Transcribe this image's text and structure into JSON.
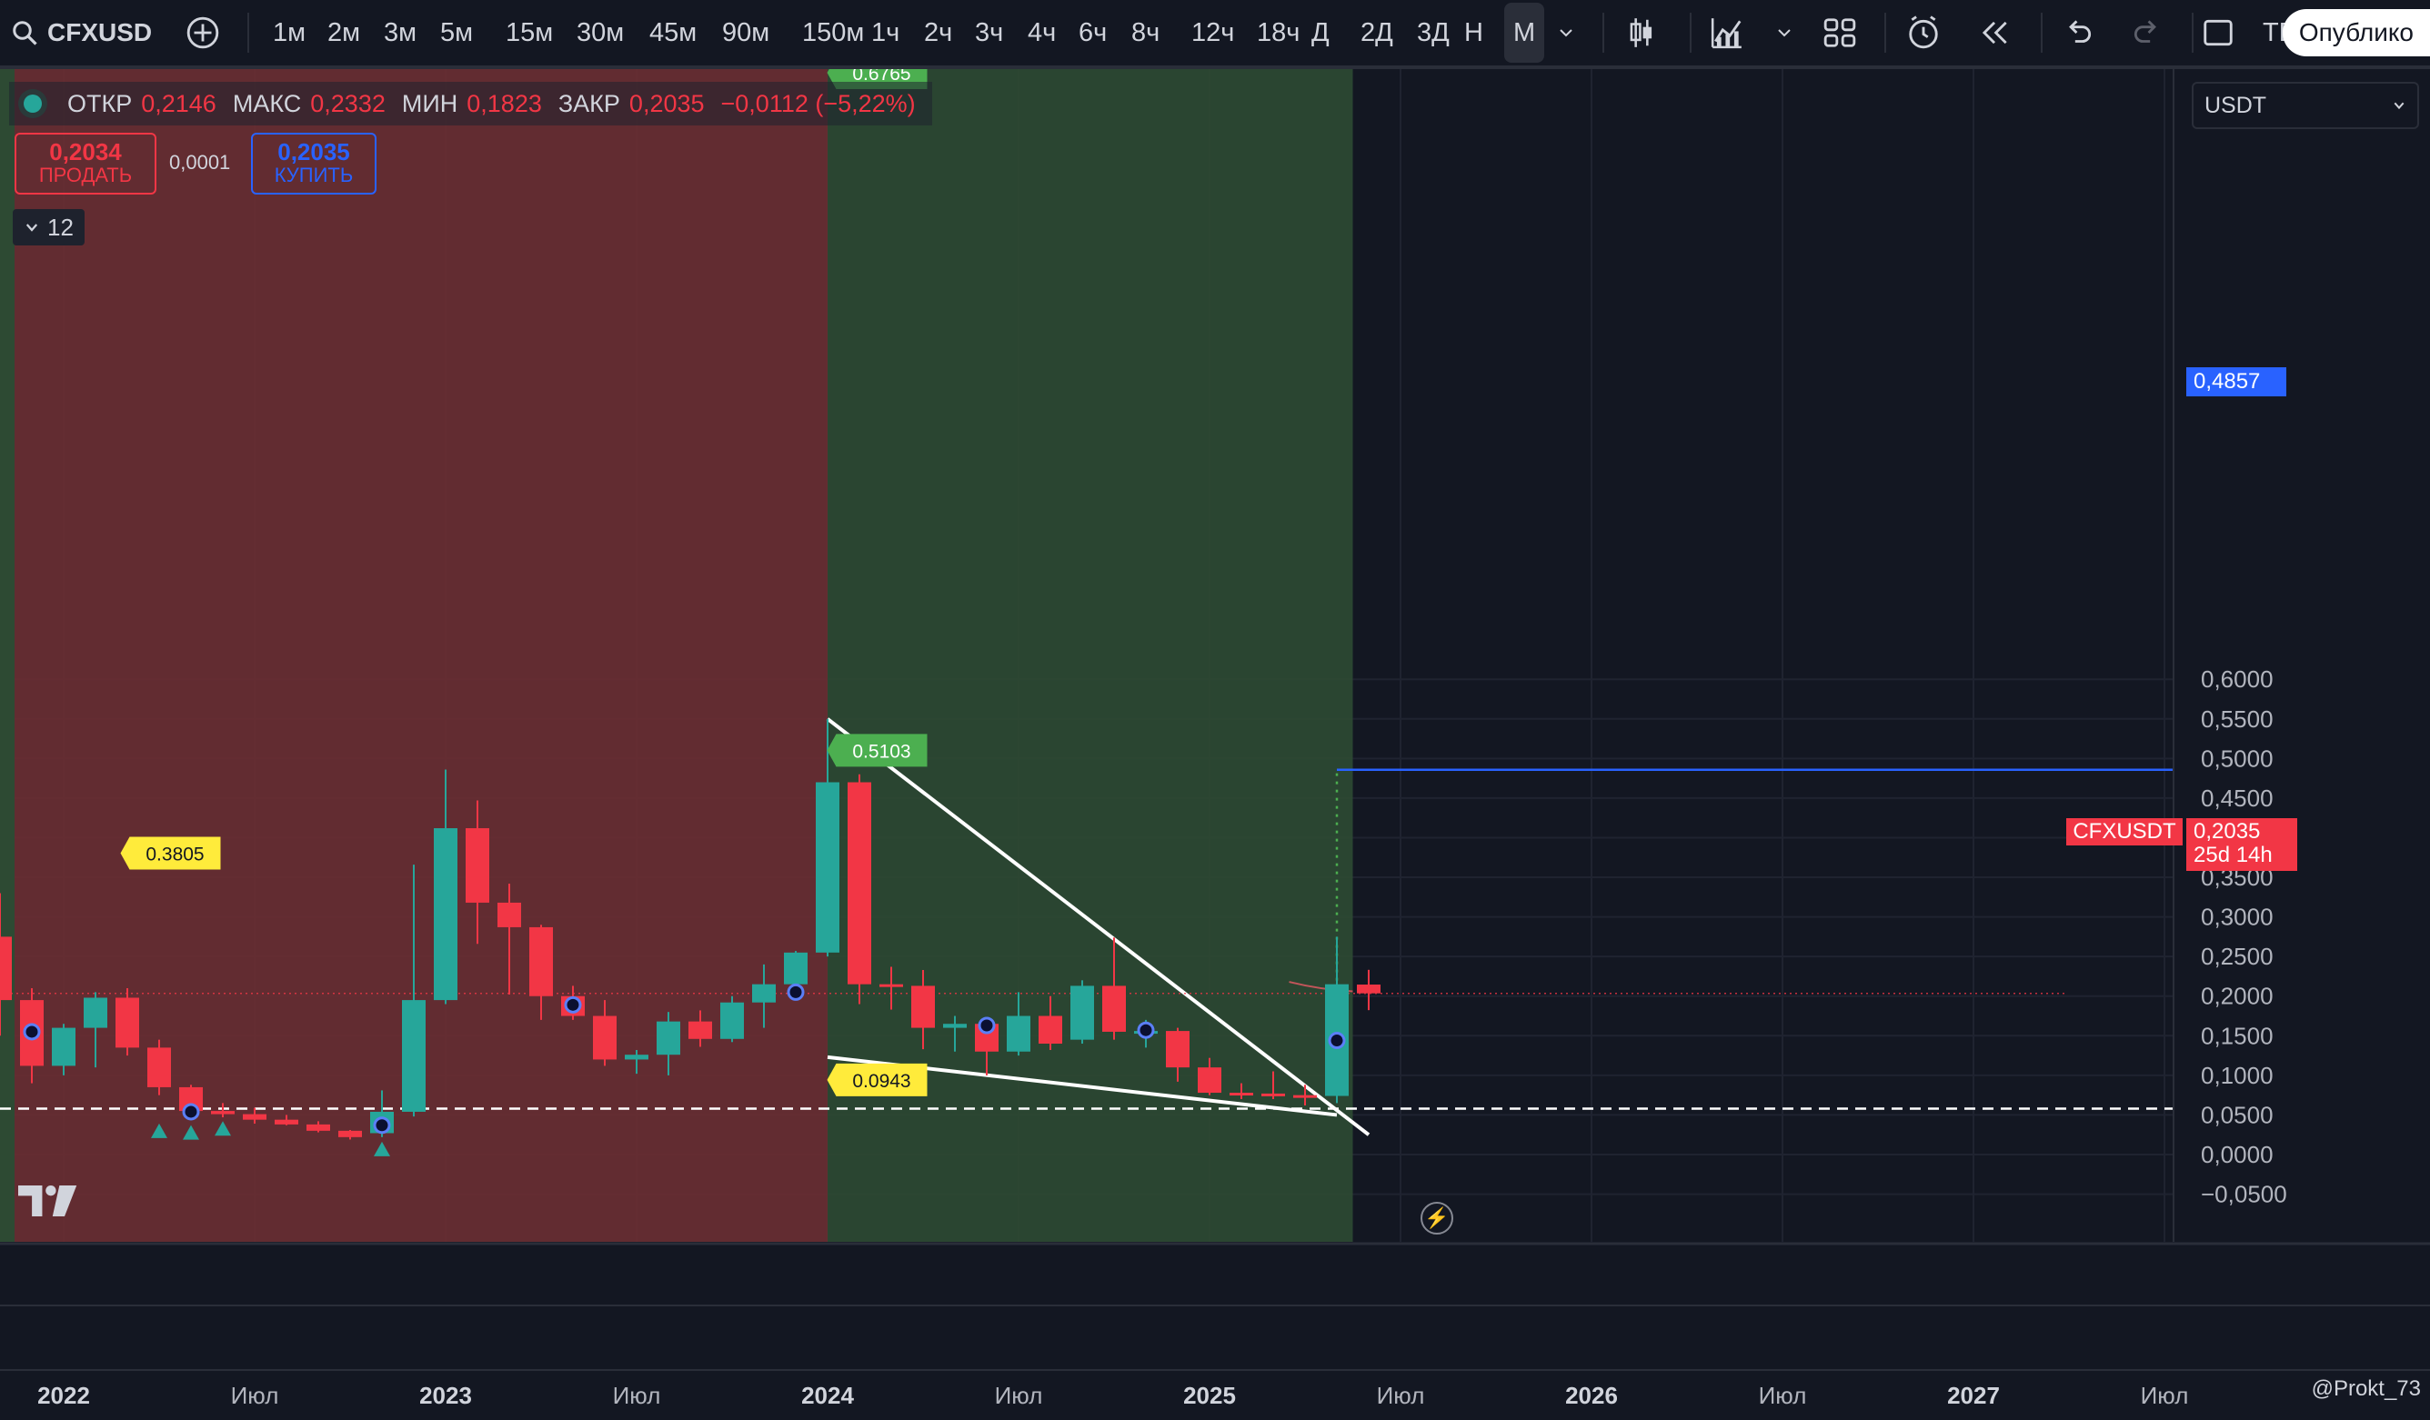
{
  "toolbar": {
    "symbol": "CFXUSD",
    "timeframes": [
      "1м",
      "2м",
      "3м",
      "5м",
      "15м",
      "30м",
      "45м",
      "90м",
      "150м",
      "1ч",
      "2ч",
      "3ч",
      "4ч",
      "6ч",
      "8ч",
      "12ч",
      "18ч",
      "Д",
      "2Д",
      "3Д",
      "Н",
      "М"
    ],
    "active_timeframe": "М",
    "truncated_label": "ТЕ",
    "publish_label": "Опублико"
  },
  "legend": {
    "open_label": "ОТКР",
    "open_value": "0,2146",
    "high_label": "МАКС",
    "high_value": "0,2332",
    "low_label": "МИН",
    "low_value": "0,1823",
    "close_label": "ЗАКР",
    "close_value": "0,2035",
    "change": "−0,0112 (−5,22%)"
  },
  "trade": {
    "sell_price": "0,2034",
    "sell_label": "ПРОДАТЬ",
    "spread": "0,0001",
    "buy_price": "0,2035",
    "buy_label": "КУПИТЬ"
  },
  "indicators_toggle": "12",
  "currency": "USDT",
  "last_price": {
    "ticker": "CFXUSDT",
    "price": "0,2035",
    "countdown": "25d 14h"
  },
  "target_price": "0,4857",
  "watermark": "@Prokt_73",
  "colors": {
    "bg": "#131722",
    "up": "#26a69a",
    "down": "#f23645",
    "accent": "#2962ff"
  },
  "chart_data": {
    "type": "candlestick",
    "timeframe": "monthly",
    "ylim": [
      -0.05,
      0.65
    ],
    "y_ticks": [
      "0,6000",
      "0,5500",
      "0,5000",
      "0,4500",
      "0,4000",
      "0,3500",
      "0,3000",
      "0,2500",
      "0,2000",
      "0,1500",
      "0,1000",
      "0,0500",
      "0,0000",
      "−0,0500"
    ],
    "y_tick_values": [
      0.6,
      0.55,
      0.5,
      0.45,
      0.4,
      0.35,
      0.3,
      0.25,
      0.2,
      0.15,
      0.1,
      0.05,
      0.0,
      -0.05
    ],
    "x_ticks": [
      {
        "label": "2022",
        "month": 0,
        "bold": true
      },
      {
        "label": "Июл",
        "month": 6,
        "bold": false
      },
      {
        "label": "2023",
        "month": 12,
        "bold": true
      },
      {
        "label": "Июл",
        "month": 18,
        "bold": false
      },
      {
        "label": "2024",
        "month": 24,
        "bold": true
      },
      {
        "label": "Июл",
        "month": 30,
        "bold": false
      },
      {
        "label": "2025",
        "month": 36,
        "bold": true
      },
      {
        "label": "Июл",
        "month": 42,
        "bold": false
      },
      {
        "label": "2026",
        "month": 48,
        "bold": true
      },
      {
        "label": "Июл",
        "month": 54,
        "bold": false
      },
      {
        "label": "2027",
        "month": 60,
        "bold": true
      },
      {
        "label": "Июл",
        "month": 66,
        "bold": false
      }
    ],
    "candles": [
      {
        "month": -4,
        "o": 0.33,
        "h": 0.38,
        "l": 0.25,
        "c": 0.28
      },
      {
        "month": -3,
        "o": 0.31,
        "h": 0.37,
        "l": 0.25,
        "c": 0.275
      },
      {
        "month": -2,
        "o": 0.275,
        "h": 0.33,
        "l": 0.15,
        "c": 0.195
      },
      {
        "month": -1,
        "o": 0.195,
        "h": 0.21,
        "l": 0.09,
        "c": 0.112
      },
      {
        "month": 0,
        "o": 0.112,
        "h": 0.165,
        "l": 0.1,
        "c": 0.16
      },
      {
        "month": 1,
        "o": 0.16,
        "h": 0.205,
        "l": 0.11,
        "c": 0.198
      },
      {
        "month": 2,
        "o": 0.198,
        "h": 0.21,
        "l": 0.125,
        "c": 0.135
      },
      {
        "month": 3,
        "o": 0.135,
        "h": 0.145,
        "l": 0.075,
        "c": 0.085
      },
      {
        "month": 4,
        "o": 0.085,
        "h": 0.088,
        "l": 0.048,
        "c": 0.055
      },
      {
        "month": 5,
        "o": 0.055,
        "h": 0.065,
        "l": 0.047,
        "c": 0.051
      },
      {
        "month": 6,
        "o": 0.051,
        "h": 0.059,
        "l": 0.039,
        "c": 0.044
      },
      {
        "month": 7,
        "o": 0.044,
        "h": 0.05,
        "l": 0.037,
        "c": 0.038
      },
      {
        "month": 8,
        "o": 0.038,
        "h": 0.042,
        "l": 0.028,
        "c": 0.03
      },
      {
        "month": 9,
        "o": 0.03,
        "h": 0.031,
        "l": 0.019,
        "c": 0.022
      },
      {
        "month": 10,
        "o": 0.027,
        "h": 0.081,
        "l": 0.022,
        "c": 0.054
      },
      {
        "month": 11,
        "o": 0.054,
        "h": 0.366,
        "l": 0.048,
        "c": 0.195
      },
      {
        "month": 12,
        "o": 0.195,
        "h": 0.486,
        "l": 0.19,
        "c": 0.412
      },
      {
        "month": 13,
        "o": 0.412,
        "h": 0.447,
        "l": 0.266,
        "c": 0.318
      },
      {
        "month": 14,
        "o": 0.318,
        "h": 0.342,
        "l": 0.202,
        "c": 0.287
      },
      {
        "month": 15,
        "o": 0.287,
        "h": 0.29,
        "l": 0.17,
        "c": 0.2
      },
      {
        "month": 16,
        "o": 0.2,
        "h": 0.213,
        "l": 0.17,
        "c": 0.175
      },
      {
        "month": 17,
        "o": 0.175,
        "h": 0.195,
        "l": 0.112,
        "c": 0.12
      },
      {
        "month": 18,
        "o": 0.12,
        "h": 0.132,
        "l": 0.102,
        "c": 0.126
      },
      {
        "month": 19,
        "o": 0.126,
        "h": 0.18,
        "l": 0.1,
        "c": 0.168
      },
      {
        "month": 20,
        "o": 0.168,
        "h": 0.182,
        "l": 0.136,
        "c": 0.146
      },
      {
        "month": 21,
        "o": 0.146,
        "h": 0.2,
        "l": 0.142,
        "c": 0.192
      },
      {
        "month": 22,
        "o": 0.192,
        "h": 0.24,
        "l": 0.16,
        "c": 0.215
      },
      {
        "month": 23,
        "o": 0.215,
        "h": 0.257,
        "l": 0.205,
        "c": 0.255
      },
      {
        "month": 24,
        "o": 0.255,
        "h": 0.55,
        "l": 0.25,
        "c": 0.47
      },
      {
        "month": 25,
        "o": 0.47,
        "h": 0.48,
        "l": 0.19,
        "c": 0.215
      },
      {
        "month": 26,
        "o": 0.215,
        "h": 0.237,
        "l": 0.183,
        "c": 0.213
      },
      {
        "month": 27,
        "o": 0.213,
        "h": 0.233,
        "l": 0.133,
        "c": 0.16
      },
      {
        "month": 28,
        "o": 0.16,
        "h": 0.175,
        "l": 0.13,
        "c": 0.165
      },
      {
        "month": 29,
        "o": 0.165,
        "h": 0.168,
        "l": 0.1,
        "c": 0.13
      },
      {
        "month": 30,
        "o": 0.13,
        "h": 0.205,
        "l": 0.125,
        "c": 0.175
      },
      {
        "month": 31,
        "o": 0.175,
        "h": 0.2,
        "l": 0.132,
        "c": 0.14
      },
      {
        "month": 32,
        "o": 0.145,
        "h": 0.22,
        "l": 0.14,
        "c": 0.213
      },
      {
        "month": 33,
        "o": 0.213,
        "h": 0.274,
        "l": 0.145,
        "c": 0.155
      },
      {
        "month": 34,
        "o": 0.155,
        "h": 0.17,
        "l": 0.135,
        "c": 0.156
      },
      {
        "month": 35,
        "o": 0.156,
        "h": 0.16,
        "l": 0.092,
        "c": 0.11
      },
      {
        "month": 36,
        "o": 0.11,
        "h": 0.122,
        "l": 0.075,
        "c": 0.078
      },
      {
        "month": 37,
        "o": 0.078,
        "h": 0.09,
        "l": 0.07,
        "c": 0.077
      },
      {
        "month": 38,
        "o": 0.077,
        "h": 0.105,
        "l": 0.07,
        "c": 0.075
      },
      {
        "month": 39,
        "o": 0.075,
        "h": 0.088,
        "l": 0.062,
        "c": 0.074
      },
      {
        "month": 40,
        "o": 0.074,
        "h": 0.275,
        "l": 0.065,
        "c": 0.215
      },
      {
        "month": 41,
        "o": 0.2146,
        "h": 0.2332,
        "l": 0.1823,
        "c": 0.2035
      }
    ],
    "zones": [
      {
        "from_month": -6,
        "to_month": 24,
        "color": "#6b2f33"
      },
      {
        "from_month": 24,
        "to_month": 40.5,
        "color": "#2d4a33"
      }
    ],
    "lines": [
      {
        "name": "upper-trendline",
        "p1": [
          24.0,
          0.55
        ],
        "p2": [
          41.0,
          0.025
        ],
        "color": "#ffffff"
      },
      {
        "name": "lower-trendline",
        "p1": [
          24.0,
          0.123
        ],
        "p2": [
          40.0,
          0.05
        ],
        "color": "#ffffff"
      },
      {
        "name": "horizontal-dashed-support",
        "p1": [
          -6,
          0.058
        ],
        "p2": [
          74,
          0.058
        ],
        "color": "#ffffff",
        "dashed": true
      },
      {
        "name": "target-line",
        "p1": [
          40.0,
          0.4857
        ],
        "p2": [
          74,
          0.4857
        ],
        "color": "#2962ff"
      },
      {
        "name": "target-dotted",
        "p1": [
          40.0,
          0.075
        ],
        "p2": [
          40.0,
          0.4857
        ],
        "color": "#4caf50",
        "dotted": true
      }
    ],
    "annotations": [
      {
        "text": "0.3805",
        "month": 3.5,
        "value": 0.3805,
        "bg": "#ffeb3b",
        "fg": "#131722"
      },
      {
        "text": "0.5103",
        "month": 25.7,
        "value": 0.5103,
        "bg": "#4caf50",
        "fg": "#ffffff"
      },
      {
        "text": "0.0943",
        "month": 25.7,
        "value": 0.0943,
        "bg": "#ffeb3b",
        "fg": "#131722"
      },
      {
        "text": "0.6765",
        "month": 25.7,
        "value": 0.6765,
        "bg": "#4caf50",
        "fg": "#ffffff",
        "clipped": true
      }
    ],
    "markers": [
      {
        "type": "dot",
        "month": -1,
        "value": 0.155
      },
      {
        "type": "dot",
        "month": 4,
        "value": 0.054
      },
      {
        "type": "dot",
        "month": 10,
        "value": 0.037
      },
      {
        "type": "dot",
        "month": 16,
        "value": 0.189
      },
      {
        "type": "dot",
        "month": 23,
        "value": 0.205
      },
      {
        "type": "dot",
        "month": 29,
        "value": 0.163
      },
      {
        "type": "dot",
        "month": 34,
        "value": 0.157
      },
      {
        "type": "dot",
        "month": 40,
        "value": 0.144
      },
      {
        "type": "up-arrow",
        "month": 3,
        "value": 0.03
      },
      {
        "type": "up-arrow",
        "month": 4,
        "value": 0.028
      },
      {
        "type": "up-arrow",
        "month": 5,
        "value": 0.033
      },
      {
        "type": "up-arrow",
        "month": 10,
        "value": 0.007
      }
    ],
    "price_line": 0.2035
  }
}
